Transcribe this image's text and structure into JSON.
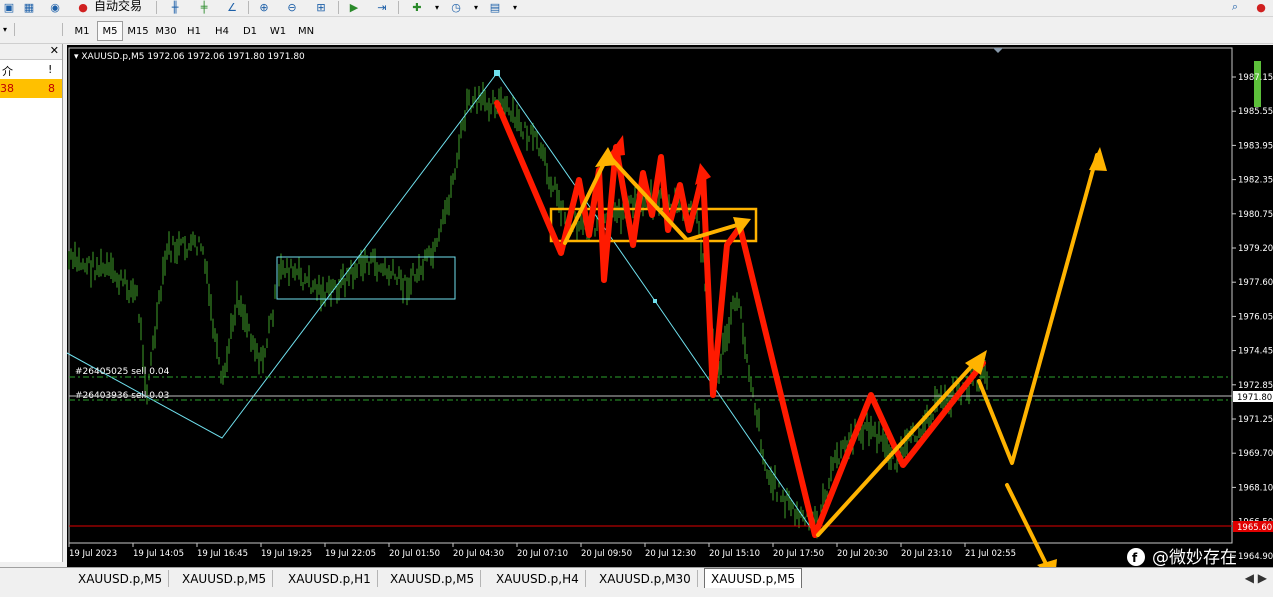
{
  "toolbar": {
    "autotrade_label": "自动交易"
  },
  "timeframes": [
    "M1",
    "M5",
    "M15",
    "M30",
    "H1",
    "H4",
    "D1",
    "W1",
    "MN"
  ],
  "active_timeframe": "M5",
  "left_panel": {
    "header_col1": "介",
    "header_col2": "!",
    "row_col1": "38",
    "row_col2": "8"
  },
  "chart": {
    "header": "XAUUSD.p,M5  1972.06 1972.06 1971.80 1971.80",
    "price_labels": [
      "1987.15",
      "1985.55",
      "1983.95",
      "1982.35",
      "1980.75",
      "1979.20",
      "1977.60",
      "1976.05",
      "1974.45",
      "1972.85",
      "1971.25",
      "1969.70",
      "1968.10",
      "1966.50",
      "1964.90"
    ],
    "current_price": "1971.80",
    "red_line_price": "1965.60",
    "time_labels": [
      "19 Jul 2023",
      "19 Jul 14:05",
      "19 Jul 16:45",
      "19 Jul 19:25",
      "19 Jul 22:05",
      "20 Jul 01:50",
      "20 Jul 04:30",
      "20 Jul 07:10",
      "20 Jul 09:50",
      "20 Jul 12:30",
      "20 Jul 15:10",
      "20 Jul 17:50",
      "20 Jul 20:30",
      "20 Jul 23:10",
      "21 Jul 02:55"
    ],
    "order_1": "#26405025 sell 0.04",
    "order_2": "#26403936 sell 0.03",
    "watermark": "@微妙存在",
    "colors": {
      "bars": "#3fa02a",
      "order_line": "#2ca02c",
      "zigzag": "#6fe0ee",
      "arrow_red": "#ff1a00",
      "arrow_yellow": "#ffb300"
    }
  },
  "tabs": [
    "XAUUSD.p,M5",
    "XAUUSD.p,M5",
    "XAUUSD.p,H1",
    "XAUUSD.p,M5",
    "XAUUSD.p,H4",
    "XAUUSD.p,M30",
    "XAUUSD.p,M5"
  ],
  "active_tab": 6
}
